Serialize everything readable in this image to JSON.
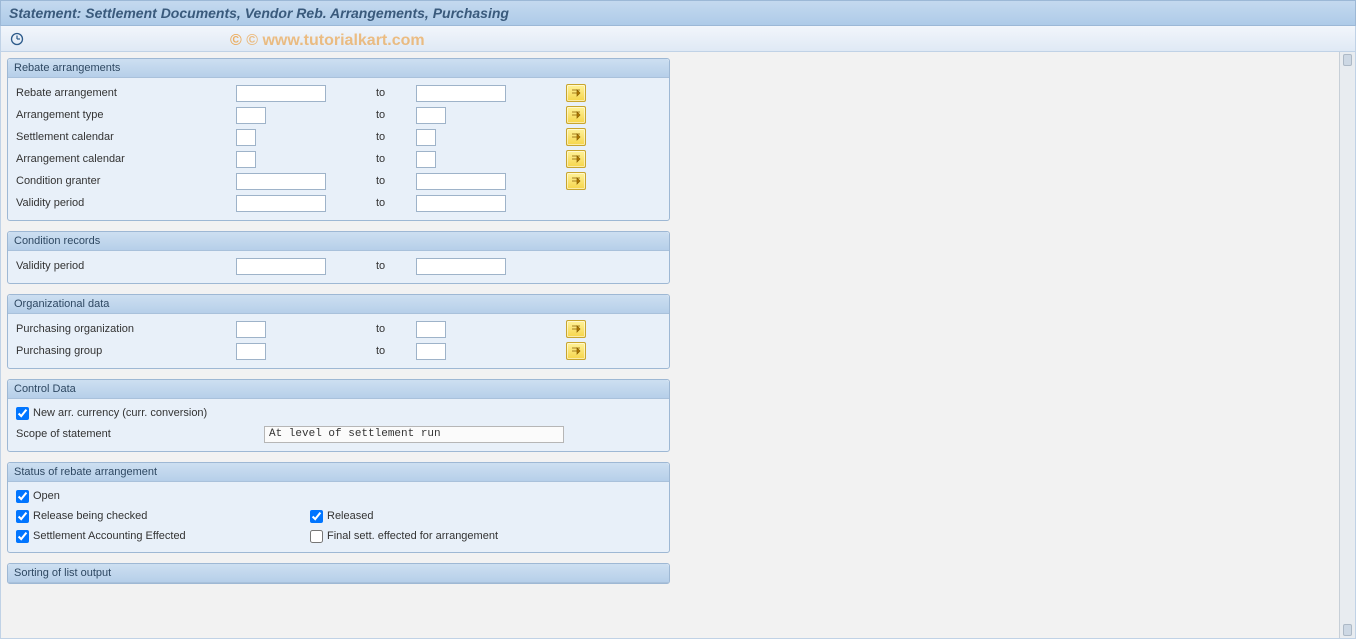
{
  "header": {
    "title": "Statement: Settlement Documents, Vendor Reb. Arrangements, Purchasing"
  },
  "watermark": "© www.tutorialkart.com",
  "groups": {
    "rebate": {
      "title": "Rebate arrangements",
      "rows": {
        "rebate_arr": {
          "label": "Rebate arrangement",
          "to": "to",
          "from_val": "",
          "to_val": ""
        },
        "arr_type": {
          "label": "Arrangement type",
          "to": "to",
          "from_val": "",
          "to_val": ""
        },
        "sett_cal": {
          "label": "Settlement calendar",
          "to": "to",
          "from_val": "",
          "to_val": ""
        },
        "arr_cal": {
          "label": "Arrangement calendar",
          "to": "to",
          "from_val": "",
          "to_val": ""
        },
        "cond_grant": {
          "label": "Condition granter",
          "to": "to",
          "from_val": "",
          "to_val": ""
        },
        "validity": {
          "label": "Validity period",
          "to": "to",
          "from_val": "",
          "to_val": ""
        }
      }
    },
    "condrec": {
      "title": "Condition records",
      "rows": {
        "validity": {
          "label": "Validity period",
          "to": "to",
          "from_val": "",
          "to_val": ""
        }
      }
    },
    "orgdata": {
      "title": "Organizational data",
      "rows": {
        "porg": {
          "label": "Purchasing organization",
          "to": "to",
          "from_val": "",
          "to_val": ""
        },
        "pgrp": {
          "label": "Purchasing group",
          "to": "to",
          "from_val": "",
          "to_val": ""
        }
      }
    },
    "control": {
      "title": "Control Data",
      "newarr_label": "New arr. currency (curr. conversion)",
      "scope_label": "Scope of statement",
      "scope_value": "At level of settlement run"
    },
    "status": {
      "title": "Status of rebate arrangement",
      "open": "Open",
      "release_chk": "Release being checked",
      "released": "Released",
      "sett_eff": "Settlement Accounting Effected",
      "final_sett": "Final sett. effected for arrangement"
    },
    "sorting": {
      "title": "Sorting of list output"
    }
  }
}
